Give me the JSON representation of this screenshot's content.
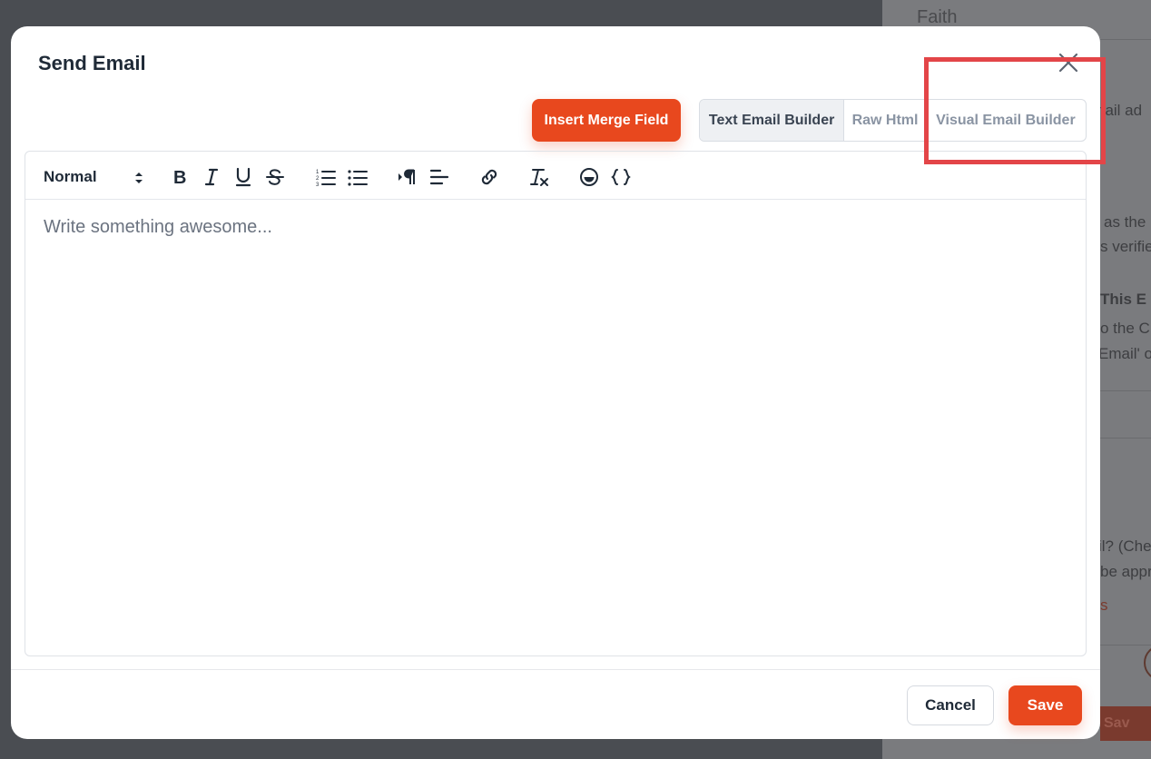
{
  "background": {
    "field_value": "Faith",
    "fragments": [
      "nail ad",
      "as the",
      "s verifie",
      "This E",
      "o the C",
      "Email' o",
      "il? (Che",
      "be appr",
      "s",
      "Sav"
    ]
  },
  "modal": {
    "title": "Send Email",
    "insert_merge_label": "Insert Merge Field",
    "builder_tabs": [
      {
        "label": "Text Email Builder",
        "active": true
      },
      {
        "label": "Raw Html",
        "active": false
      },
      {
        "label": "Visual Email Builder",
        "active": false
      }
    ],
    "toolbar": {
      "format_value": "Normal"
    },
    "editor_placeholder": "Write something awesome...",
    "cancel_label": "Cancel",
    "save_label": "Save"
  },
  "colors": {
    "accent": "#e8481e",
    "highlight": "#e34548",
    "text": "#1f2a37"
  }
}
